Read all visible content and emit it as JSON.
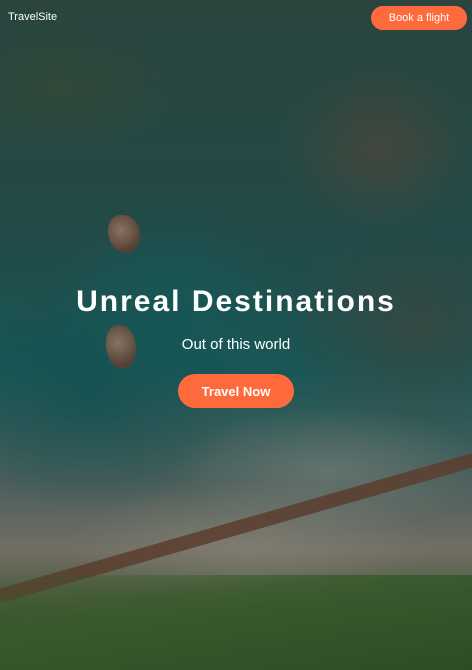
{
  "nav": {
    "brand": "TravelSite",
    "book_label": "Book a flight"
  },
  "hero": {
    "headline": "Unreal Destinations",
    "tagline": "Out of this world",
    "cta_label": "Travel Now"
  },
  "colors": {
    "accent": "#ff6a3d",
    "text": "#ffffff"
  }
}
